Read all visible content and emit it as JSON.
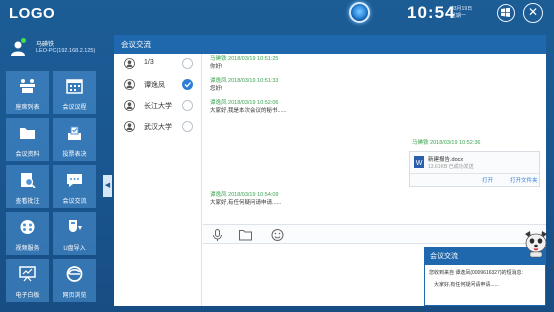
{
  "header": {
    "logo": "LOGO",
    "time": "10:54",
    "date": "03月19日",
    "weekday": "星期一"
  },
  "user": {
    "name": "马碘铁",
    "host": "LEO-PC(192.168.2.125)"
  },
  "tiles": [
    {
      "label": "座席列表",
      "icon": "seating-icon"
    },
    {
      "label": "会议议程",
      "icon": "calendar-icon"
    },
    {
      "label": "会议资料",
      "icon": "folder-icon"
    },
    {
      "label": "投票表决",
      "icon": "vote-icon"
    },
    {
      "label": "查看批注",
      "icon": "annotation-icon"
    },
    {
      "label": "会议交流",
      "icon": "chat-icon"
    },
    {
      "label": "视频服务",
      "icon": "video-icon"
    },
    {
      "label": "U盘导入",
      "icon": "usb-icon"
    },
    {
      "label": "电子白板",
      "icon": "whiteboard-icon"
    },
    {
      "label": "网页浏览",
      "icon": "browser-icon"
    }
  ],
  "window": {
    "title": "会议交流",
    "members_count": "1/3",
    "members": [
      {
        "name": "谭逸凤",
        "checked": true
      },
      {
        "name": "长江大学",
        "checked": false
      },
      {
        "name": "武汉大学",
        "checked": false
      }
    ],
    "messages": [
      {
        "who": "马碘铁 2018/03/19 10:51:25",
        "text": "你好!"
      },
      {
        "who": "谭逸凤 2018/03/19 10:51:33",
        "text": "您好!"
      },
      {
        "who": "谭逸凤 2018/03/19 10:52:06",
        "text": "大家好,我是本次会议的秘书......"
      },
      {
        "who": "谭逸凤 2018/03/19 10:54:09",
        "text": "大家好,有任何疑问请申请......"
      }
    ],
    "file_message": {
      "who": "马碘铁 2018/03/19 10:52:36",
      "filename": "新建报告.docx",
      "info": "13.61KB 已成功发送",
      "open": "打开",
      "open_folder": "打开文件夹"
    },
    "toolbar": [
      "mic-icon",
      "folder-icon",
      "emoji-icon"
    ]
  },
  "notification": {
    "title": "会议交流",
    "line1": "您收到来自 谭逸凤(0009616327)的短消息:",
    "line2": "大家好,有任何疑问请申请......"
  }
}
